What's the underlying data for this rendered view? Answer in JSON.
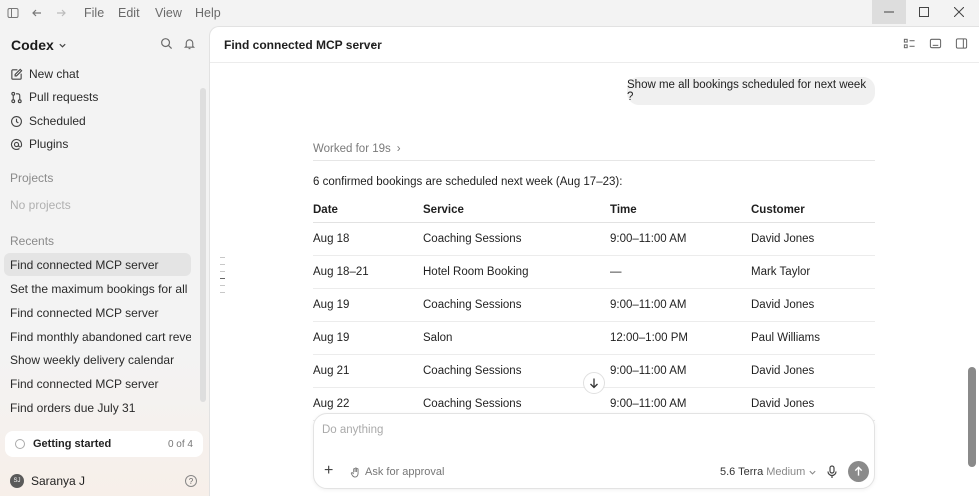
{
  "menu": {
    "file": "File",
    "edit": "Edit",
    "view": "View",
    "help": "Help"
  },
  "sidebar": {
    "app_name": "Codex",
    "nav": [
      {
        "label": "New chat",
        "icon": "edit-icon"
      },
      {
        "label": "Pull requests",
        "icon": "pull-request-icon"
      },
      {
        "label": "Scheduled",
        "icon": "clock-icon"
      },
      {
        "label": "Plugins",
        "icon": "at-icon"
      }
    ],
    "projects_heading": "Projects",
    "projects_empty": "No projects",
    "recents_heading": "Recents",
    "recents": [
      "Find connected MCP server",
      "Set the maximum bookings for all ca",
      "Find connected MCP server",
      "Find monthly abandoned cart revenu",
      "Show weekly delivery calendar",
      "Find connected MCP server",
      "Find orders due July 31"
    ],
    "getting_started": {
      "label": "Getting started",
      "count": "0 of 4",
      "progress": 0
    },
    "user": {
      "name": "Saranya J",
      "initials": "SJ"
    }
  },
  "header": {
    "title": "Find connected MCP server",
    "more": "···"
  },
  "chat": {
    "user_message": "Show me all bookings scheduled for next week ?",
    "worked_for": "Worked for 19s",
    "summary": "6 confirmed bookings are scheduled next week (Aug 17–23):",
    "table": {
      "headers": [
        "Date",
        "Service",
        "Time",
        "Customer"
      ],
      "rows": [
        [
          "Aug 18",
          "Coaching Sessions",
          "9:00–11:00 AM",
          "David Jones"
        ],
        [
          "Aug 18–21",
          "Hotel Room Booking",
          "—",
          "Mark Taylor"
        ],
        [
          "Aug 19",
          "Coaching Sessions",
          "9:00–11:00 AM",
          "David Jones"
        ],
        [
          "Aug 19",
          "Salon",
          "12:00–1:00 PM",
          "Paul Williams"
        ],
        [
          "Aug 21",
          "Coaching Sessions",
          "9:00–11:00 AM",
          "David Jones"
        ],
        [
          "Aug 22",
          "Coaching Sessions",
          "9:00–11:00 AM",
          "David Jones"
        ]
      ]
    }
  },
  "composer": {
    "placeholder": "Do anything",
    "approval": "Ask for approval",
    "model": "5.6 Terra",
    "level": "Medium"
  },
  "colors": {
    "active_bg": "#e4e4e4",
    "send_bg": "#8a8a8a"
  }
}
